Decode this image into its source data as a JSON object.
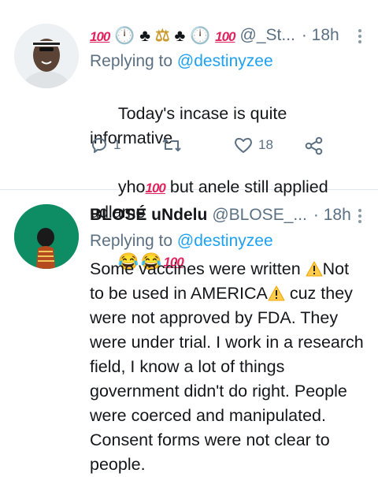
{
  "tweets": [
    {
      "handle": "@_St...",
      "name_emojis": [
        "💯",
        "🕛",
        "♣️",
        "⚖️",
        "♣️",
        "🕛",
        "💯"
      ],
      "time": "· 18h",
      "replying_label": "Replying to",
      "replying_to": "@destinyzee",
      "text_line1": "Today's incase is quite informative",
      "text_line2_pre": "yho",
      "text_line2_post": " but anele still applied udlame",
      "reply_count": "1",
      "retweet_count": "",
      "like_count": "18"
    },
    {
      "name": "BLOSÉ uNdelu",
      "handle": "@BLOSE_...",
      "time": "· 18h",
      "replying_label": "Replying to",
      "replying_to": "@destinyzee",
      "text_a": "Some vaccines were written ",
      "text_b": "Not",
      "text_c": "to be used in AMERICA",
      "text_d": " cuz they",
      "text_e": "were not approved by FDA. They\nwere under trial. I work in a research\nfield, I know a lot of things\ngovernment didn't do right. People\nwere coerced and manipulated.\nConsent forms were not clear to\npeople."
    }
  ],
  "icons": {
    "reply": "comment-icon",
    "retweet": "retweet-icon",
    "like": "heart-icon",
    "share": "share-icon",
    "warning": "warning-icon",
    "more": "more-vertical-icon"
  },
  "colors": {
    "link": "#1da1f2",
    "secondary": "#5b7083",
    "hundred": "#e0245e"
  }
}
